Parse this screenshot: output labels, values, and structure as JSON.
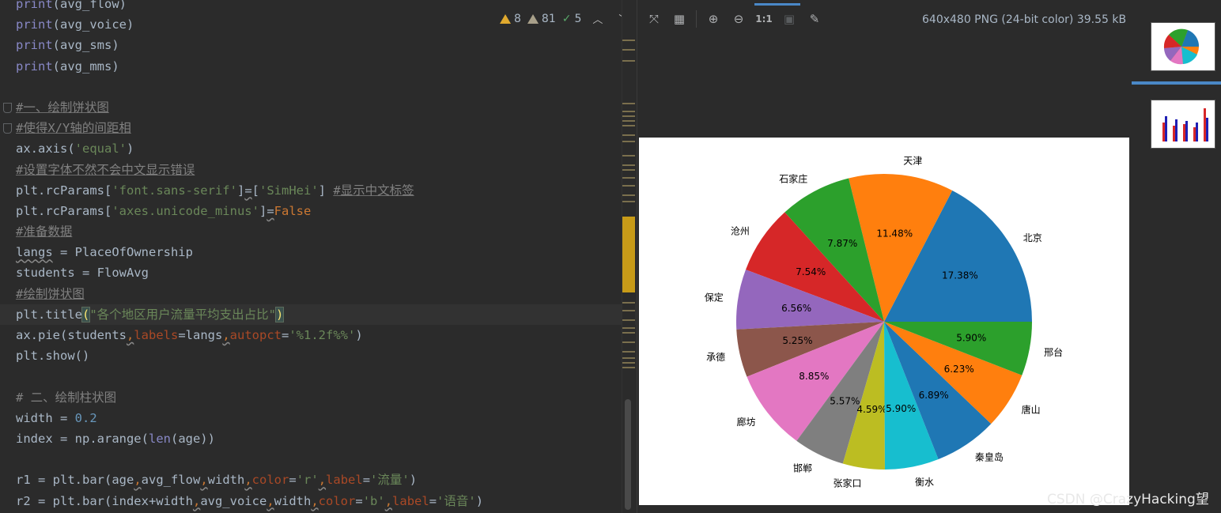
{
  "editor": {
    "inspections": {
      "warnings": "8",
      "weak_warnings": "81",
      "typos": "5"
    },
    "lines": [
      "print(avg_flow)",
      "print(avg_voice)",
      "print(avg_sms)",
      "print(avg_mms)",
      "",
      "#一、绘制饼状图",
      "#使得X/Y轴的间距相",
      "ax.axis('equal')",
      "#设置字体不然不会中文显示错误",
      "plt.rcParams['font.sans-serif']=['SimHei'] #显示中文标签",
      "plt.rcParams['axes.unicode_minus']=False",
      "#准备数据",
      "langs = PlaceOfOwnership",
      "students = FlowAvg",
      "#绘制饼状图",
      "plt.title(\"各个地区用户流量平均支出占比\")",
      "ax.pie(students,labels=langs,autopct='%1.2f%%')",
      "plt.show()",
      "",
      "# 二、绘制柱状图",
      "width = 0.2",
      "index = np.arange(len(age))",
      "",
      "r1 = plt.bar(age,avg_flow,width,color='r',label='流量')",
      "r2 = plt.bar(index+width,avg_voice,width,color='b',label='语音')"
    ],
    "tokens": {
      "print": "print",
      "open": "(",
      "close": ")",
      "l0_arg": "avg_flow",
      "l1_arg": "avg_voice",
      "l2_arg": "avg_sms",
      "l3_arg": "avg_mms",
      "l5": "#一、绘制饼状图",
      "l6": "#使得X/Y轴的间距相",
      "l7_a": "ax.axis(",
      "l7_b": "'equal'",
      "l8": "#设置字体不然不会中文显示错误",
      "l9_a": "plt.rcParams[",
      "l9_b": "'font.sans-serif'",
      "l9_c": "]",
      "l9_eq": "=",
      "l9_d": "[",
      "l9_e": "'SimHei'",
      "l9_f": "] ",
      "l9_g": "#显示中文标签",
      "l10_a": "plt.rcParams[",
      "l10_b": "'axes.unicode_minus'",
      "l10_c": "]",
      "l10_eq": "=",
      "l10_d": "False",
      "l11": "#准备数据",
      "l12_a": "langs",
      "l12_b": " = PlaceOfOwnership",
      "l13": "students = FlowAvg",
      "l14": "#绘制饼状图",
      "l15_a": "plt.title",
      "l15_b": "\"各个地区用户流量平均支出占比\"",
      "l16_a": "ax.pie(students",
      "comma": ",",
      "l16_b": "labels",
      "l16_c": "=langs",
      "l16_d": "autopct",
      "l16_e": "=",
      "l16_f": "'%1.2f%%'",
      "l17": "plt.show()",
      "l19": "# 二、绘制柱状图",
      "l20_a": "width = ",
      "l20_b": "0.2",
      "l21_a": "index = np.arange(",
      "l21_b": "len",
      "l21_c": "(age))",
      "l23_a": "r1 = plt.bar(age",
      "l23_b": "avg_flow",
      "l23_c": "width",
      "l23_d": "color",
      "eq": "=",
      "l23_e": "'r'",
      "label": "label",
      "l23_f": "'流量'",
      "l24_a": "r2 = plt.bar(index+width",
      "l24_b": "avg_voice",
      "l24_e": "'b'",
      "l24_f": "'语音'"
    }
  },
  "viewer": {
    "image_info": "640x480 PNG (24-bit color) 39.55 kB",
    "zoom_label": "1:1",
    "icons": [
      "fit-icon",
      "grid-icon",
      "zoom-in-icon",
      "zoom-out-icon",
      "actual-size-icon",
      "background-icon",
      "color-picker-icon"
    ]
  },
  "chart_data": {
    "type": "pie",
    "title": "",
    "labels": [
      "北京",
      "天津",
      "石家庄",
      "沧州",
      "保定",
      "承德",
      "廊坊",
      "邯郸",
      "张家口",
      "衡水",
      "秦皇岛",
      "唐山",
      "邢台"
    ],
    "values": [
      17.38,
      11.48,
      7.87,
      7.54,
      6.56,
      5.25,
      8.85,
      5.57,
      4.59,
      5.9,
      6.89,
      6.23,
      5.9
    ],
    "pct_labels": [
      "17.38%",
      "11.48%",
      "7.87%",
      "7.54%",
      "6.56%",
      "5.25%",
      "8.85%",
      "5.57%",
      "4.59%",
      "5.90%",
      "6.89%",
      "6.23%",
      "5.90%"
    ],
    "colors": [
      "#1f77b4",
      "#ff7f0e",
      "#2ca02c",
      "#d62728",
      "#9467bd",
      "#8c564b",
      "#e377c2",
      "#7f7f7f",
      "#bcbd22",
      "#17becf",
      "#1f77b4",
      "#ff7f0e",
      "#2ca02c"
    ]
  },
  "watermark": "CSDN @CrazyHacking望"
}
